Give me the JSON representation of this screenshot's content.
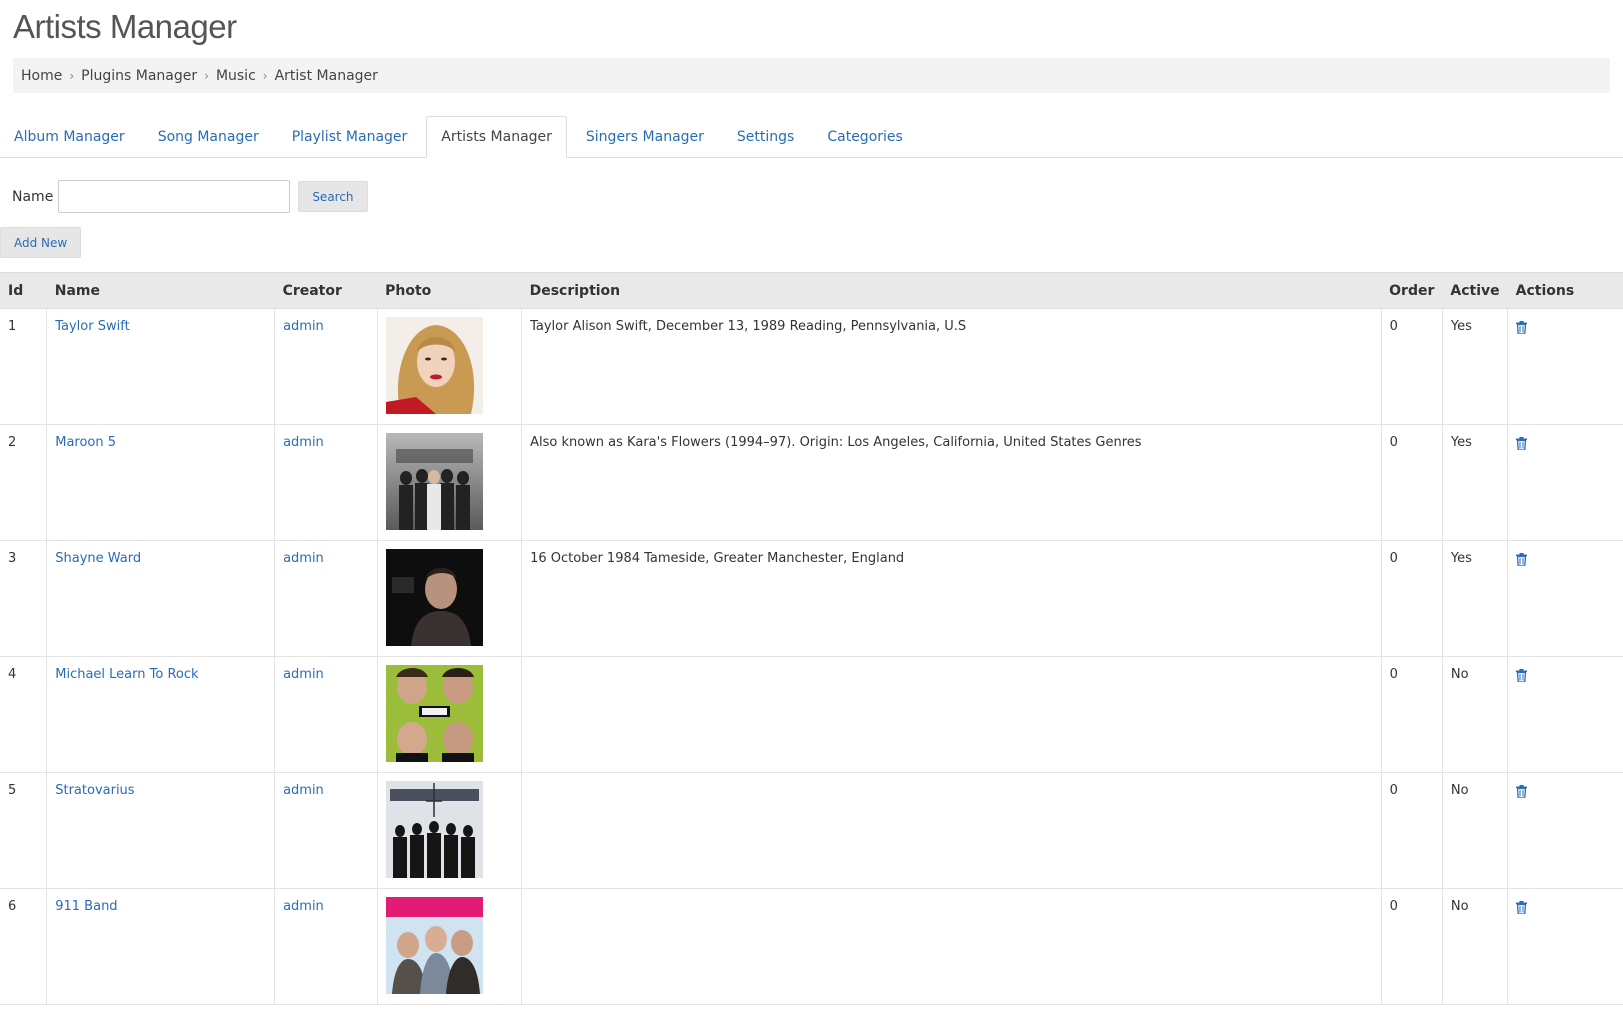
{
  "page": {
    "title": "Artists Manager"
  },
  "breadcrumb": [
    "Home",
    "Plugins Manager",
    "Music",
    "Artist Manager"
  ],
  "tabs": [
    {
      "label": "Album Manager",
      "active": false
    },
    {
      "label": "Song Manager",
      "active": false
    },
    {
      "label": "Playlist Manager",
      "active": false
    },
    {
      "label": "Artists Manager",
      "active": true
    },
    {
      "label": "Singers Manager",
      "active": false
    },
    {
      "label": "Settings",
      "active": false
    },
    {
      "label": "Categories",
      "active": false
    }
  ],
  "search": {
    "label": "Name",
    "value": "",
    "button": "Search"
  },
  "add_button": "Add New",
  "table": {
    "headers": [
      "Id",
      "Name",
      "Creator",
      "Photo",
      "Description",
      "Order",
      "Active",
      "Actions"
    ],
    "rows": [
      {
        "id": "1",
        "name": "Taylor Swift",
        "creator": "admin",
        "photo": "taylor-swift-photo",
        "description": "Taylor Alison Swift, December 13, 1989 Reading, Pennsylvania, U.S",
        "order": "0",
        "active": "Yes"
      },
      {
        "id": "2",
        "name": "Maroon 5",
        "creator": "admin",
        "photo": "maroon-5-photo",
        "description": "Also known as Kara's Flowers (1994–97). Origin: Los Angeles, California, United States Genres",
        "order": "0",
        "active": "Yes"
      },
      {
        "id": "3",
        "name": "Shayne Ward",
        "creator": "admin",
        "photo": "shayne-ward-photo",
        "description": "16 October 1984 Tameside, Greater Manchester, England",
        "order": "0",
        "active": "Yes"
      },
      {
        "id": "4",
        "name": "Michael Learn To Rock",
        "creator": "admin",
        "photo": "mltr-photo",
        "description": "",
        "order": "0",
        "active": "No"
      },
      {
        "id": "5",
        "name": "Stratovarius",
        "creator": "admin",
        "photo": "stratovarius-photo",
        "description": "",
        "order": "0",
        "active": "No"
      },
      {
        "id": "6",
        "name": "911 Band",
        "creator": "admin",
        "photo": "911-band-photo",
        "description": "",
        "order": "0",
        "active": "No"
      }
    ]
  },
  "icons": {
    "delete": "trash-icon",
    "breadcrumb_separator": "chevron-right-icon"
  },
  "colors": {
    "link": "#2a6cb5",
    "header_bg": "#e9e9e9",
    "breadcrumb_bg": "#f3f3f3"
  }
}
